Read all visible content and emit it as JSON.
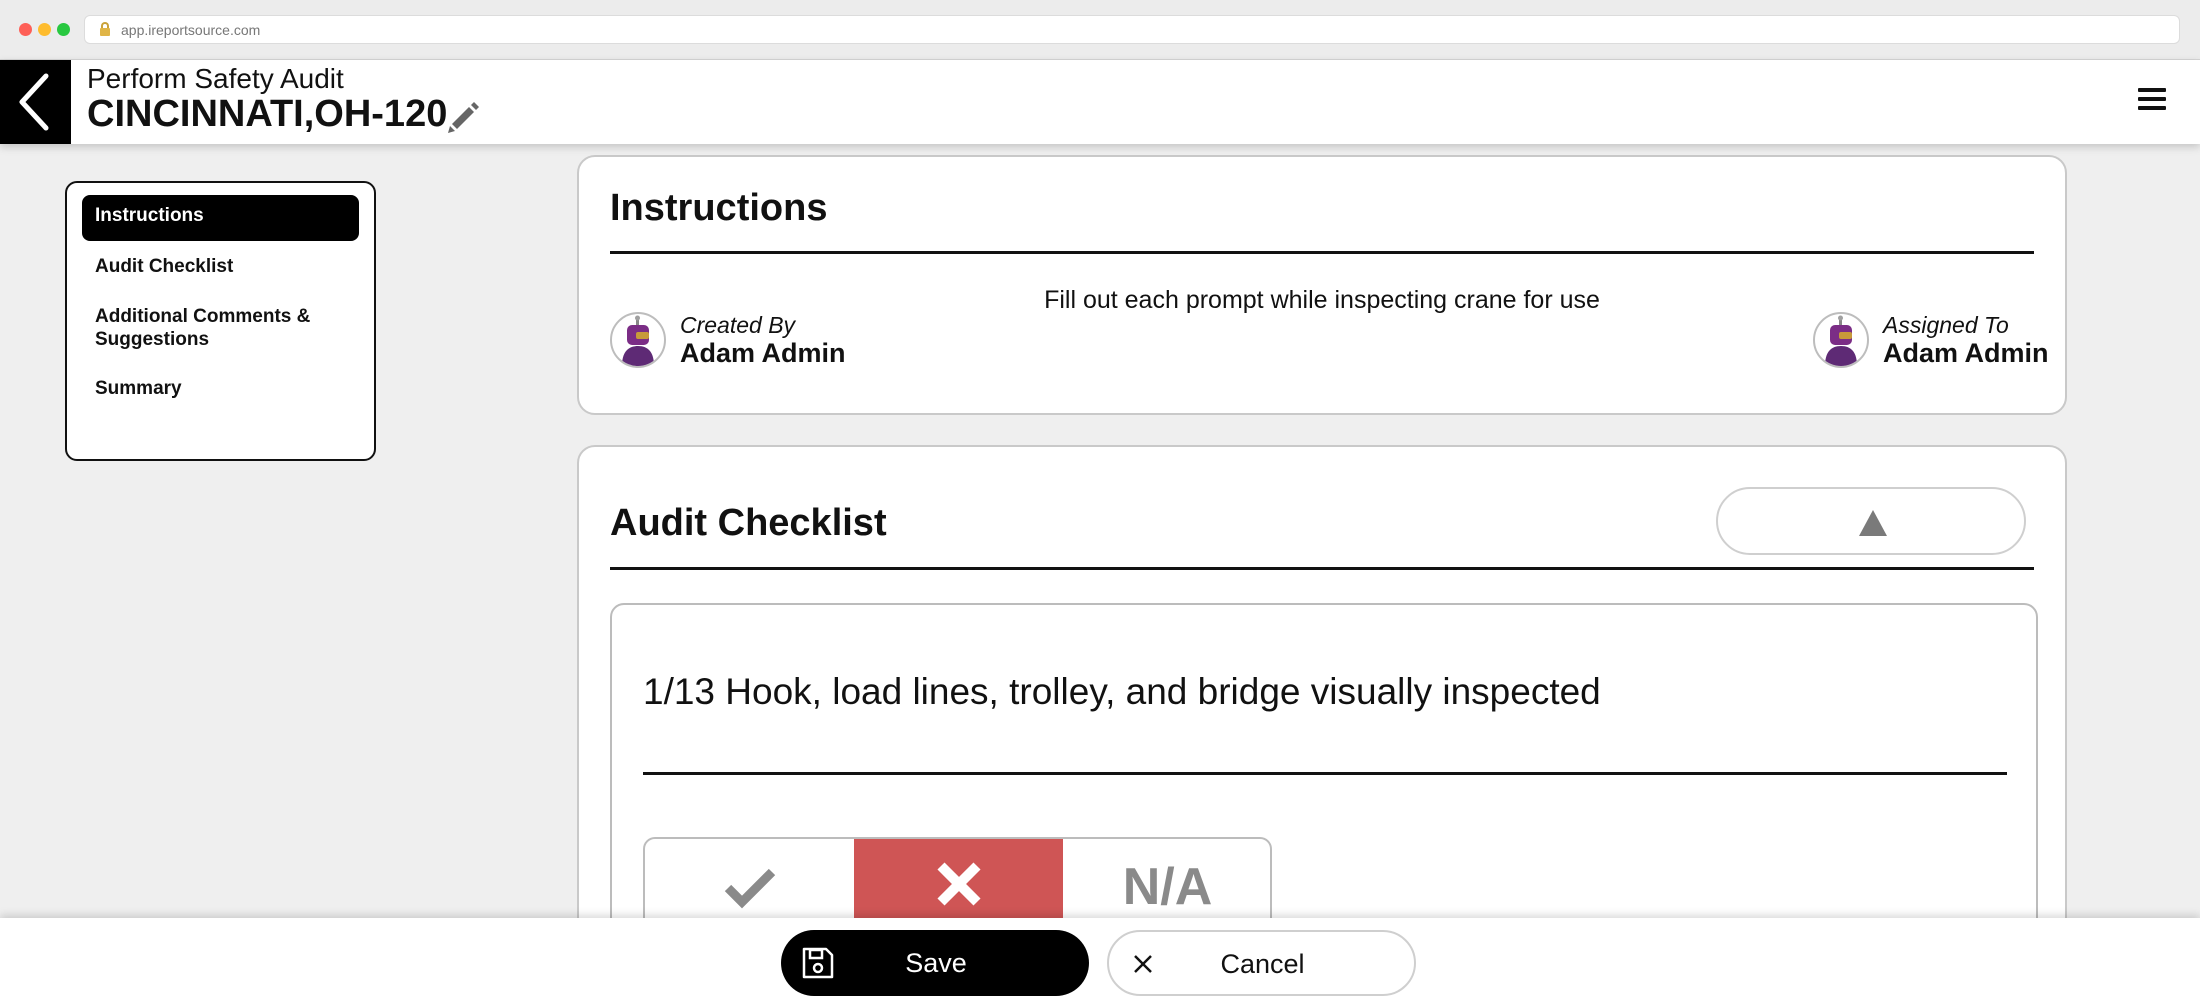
{
  "browser": {
    "url": "app.ireportsource.com"
  },
  "header": {
    "subtitle": "Perform Safety Audit",
    "title": "CINCINNATI,OH-120"
  },
  "sidebar": {
    "items": [
      {
        "label": "Instructions",
        "active": true
      },
      {
        "label": "Audit Checklist",
        "active": false
      },
      {
        "label": "Additional Comments & Suggestions",
        "active": false
      },
      {
        "label": "Summary",
        "active": false
      }
    ]
  },
  "instructions": {
    "title": "Instructions",
    "text": "Fill out each prompt while inspecting crane for use",
    "created_by_label": "Created By",
    "created_by_name": "Adam Admin",
    "assigned_to_label": "Assigned To",
    "assigned_to_name": "Adam Admin"
  },
  "checklist": {
    "title": "Audit Checklist",
    "item": {
      "question": "1/13 Hook, load lines, trolley, and bridge visually inspected",
      "answers": [
        {
          "id": "yes",
          "icon": "checkmark-icon",
          "selected": false
        },
        {
          "id": "no",
          "icon": "x-icon",
          "selected": true
        },
        {
          "id": "na",
          "label": "N/A",
          "selected": false
        }
      ]
    }
  },
  "footer": {
    "save_label": "Save",
    "cancel_label": "Cancel"
  },
  "colors": {
    "header_black": "#000000",
    "selected_no": "#cf5555",
    "background": "#efefef"
  }
}
